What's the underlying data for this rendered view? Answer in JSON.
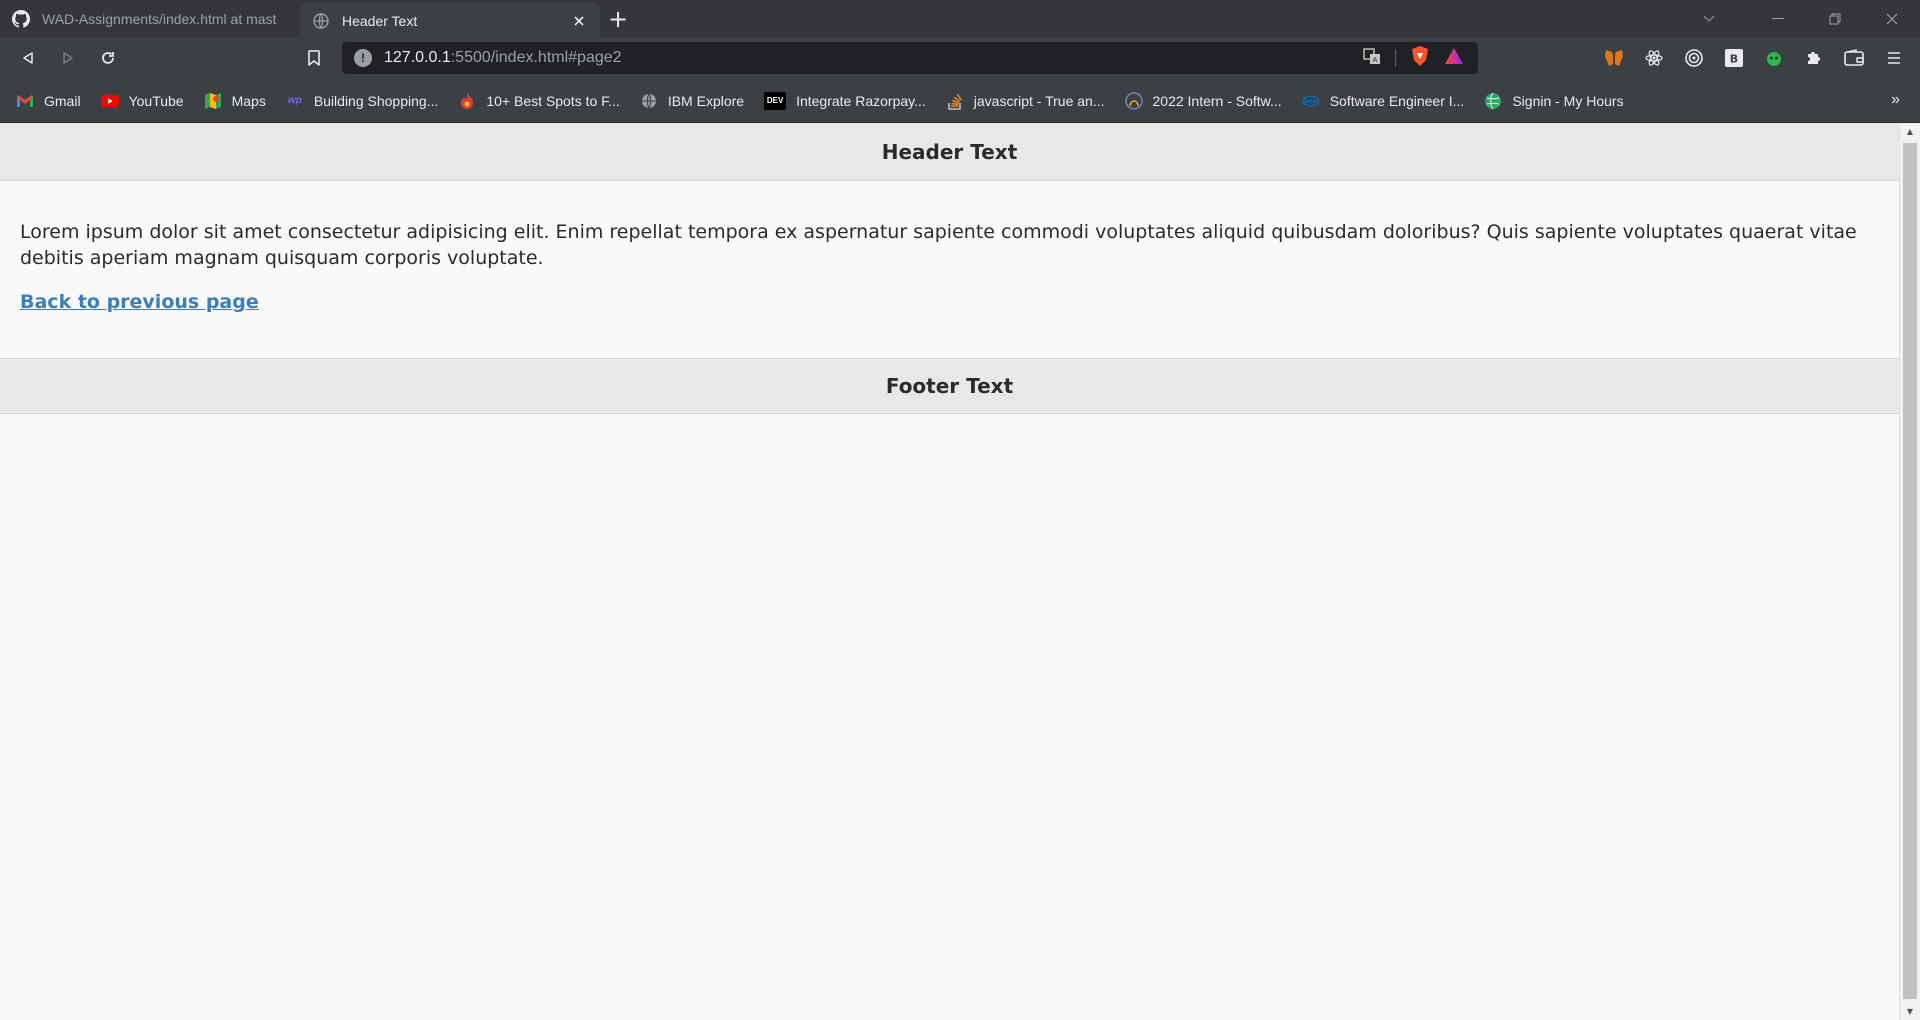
{
  "tabs": [
    {
      "title": "WAD-Assignments/index.html at mast",
      "icon": "github-icon",
      "active": false
    },
    {
      "title": "Header Text",
      "icon": "globe-icon",
      "active": true
    }
  ],
  "new_tab_label": "+",
  "address": {
    "host": "127.0.0.1",
    "rest": ":5500/index.html#page2"
  },
  "bookmarks": [
    {
      "label": "Gmail",
      "icon": "gmail-icon"
    },
    {
      "label": "YouTube",
      "icon": "youtube-icon"
    },
    {
      "label": "Maps",
      "icon": "maps-icon"
    },
    {
      "label": "Building Shopping...",
      "icon": "wp-icon"
    },
    {
      "label": "10+ Best Spots to F...",
      "icon": "spots-icon"
    },
    {
      "label": "IBM Explore",
      "icon": "globe-icon"
    },
    {
      "label": "Integrate Razorpay...",
      "icon": "dev-icon"
    },
    {
      "label": "javascript - True an...",
      "icon": "stackoverflow-icon"
    },
    {
      "label": "2022 Intern - Softw...",
      "icon": "intern-icon"
    },
    {
      "label": "Software Engineer I...",
      "icon": "intel-icon"
    },
    {
      "label": "Signin - My Hours",
      "icon": "myhours-icon"
    }
  ],
  "bookmark_overflow": "»",
  "page": {
    "header": "Header Text",
    "paragraph": "Lorem ipsum dolor sit amet consectetur adipisicing elit. Enim repellat tempora ex aspernatur sapiente commodi voluptates aliquid quibusdam doloribus? Quis sapiente voluptates quaerat vitae debitis aperiam magnam quisquam corporis voluptate.",
    "link": "Back to previous page",
    "footer": "Footer Text"
  },
  "colors": {
    "link": "#3d7eb5",
    "header_bg": "#e8e8e8",
    "page_bg": "#f9f9f9"
  }
}
